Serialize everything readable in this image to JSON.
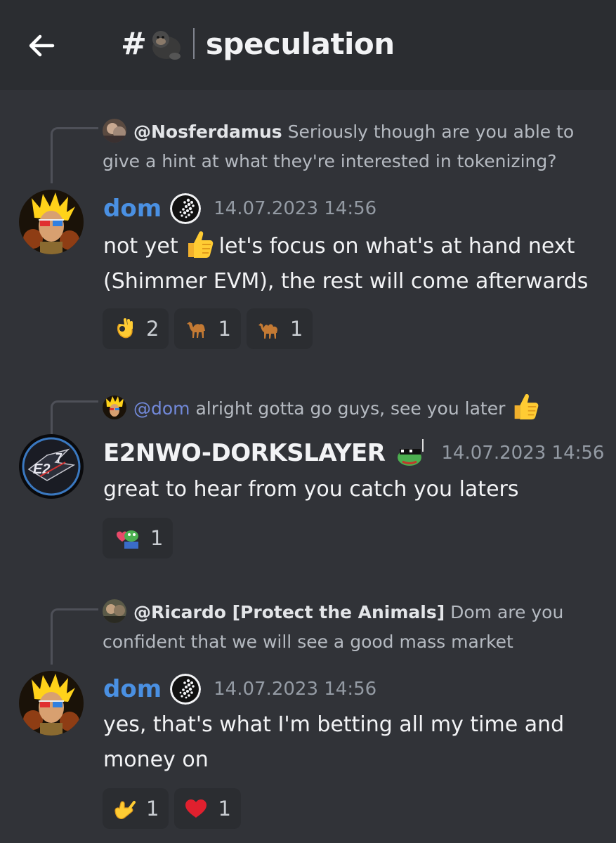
{
  "header": {
    "channel_prefix": "#",
    "channel_emoji": "gorilla-icon",
    "channel_name": "speculation"
  },
  "messages": [
    {
      "reply": {
        "mention": "@Nosferdamus",
        "text": "Seriously though are you able to give a hint at what they're interested in tokenizing?"
      },
      "author": "dom",
      "timestamp": "14.07.2023 14:56",
      "body_before": "not yet",
      "body_after": "let's focus on what's at hand next (Shimmer EVM), the rest will come afterwards",
      "reactions": [
        {
          "emoji": "ok-hand-icon",
          "count": "2"
        },
        {
          "emoji": "camel-icon",
          "count": "1"
        },
        {
          "emoji": "two-hump-camel-icon",
          "count": "1"
        }
      ]
    },
    {
      "reply": {
        "mention": "@dom",
        "text": "alright gotta go guys, see you later"
      },
      "author": "E2NWO-DORKSLAYER",
      "timestamp": "14.07.2023 14:56",
      "body": "great to hear from you catch you laters",
      "reactions": [
        {
          "emoji": "pepe-heart-icon",
          "count": "1"
        }
      ]
    },
    {
      "reply": {
        "mention": "@Ricardo [Protect the Animals]",
        "text": "Dom are you confident that we will see a good mass market"
      },
      "author": "dom",
      "timestamp": "14.07.2023 14:56",
      "body": "yes, that's what I'm betting all my time and money on",
      "reactions": [
        {
          "emoji": "call-me-hand-icon",
          "count": "1"
        },
        {
          "emoji": "red-heart-icon",
          "count": "1"
        }
      ]
    }
  ],
  "colors": {
    "background": "#313338",
    "header": "#2b2d31",
    "dom_name": "#4a90e2",
    "mention_blue": "#7289da"
  }
}
